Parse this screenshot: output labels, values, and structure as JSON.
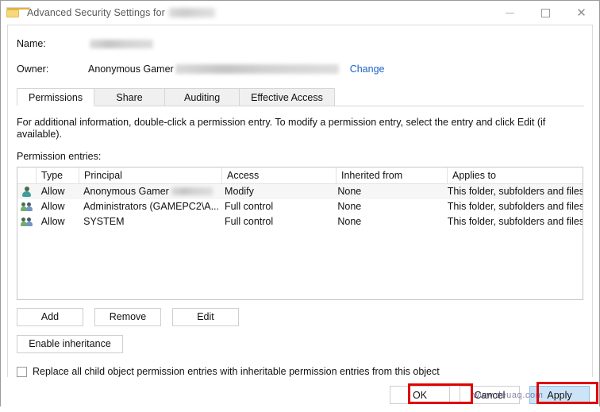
{
  "window": {
    "title_prefix": "Advanced Security Settings for",
    "title_target_redacted": true,
    "icon": "folder-icon",
    "controls": {
      "minimize": "–",
      "maximize": "□",
      "close": "✕"
    }
  },
  "fields": {
    "name_label": "Name:",
    "name_value_redacted": true,
    "owner_label": "Owner:",
    "owner_value": "Anonymous Gamer",
    "owner_email_redacted": true,
    "change_link": "Change"
  },
  "tabs": [
    {
      "label": "Permissions",
      "active": true
    },
    {
      "label": "Share",
      "active": false
    },
    {
      "label": "Auditing",
      "active": false
    },
    {
      "label": "Effective Access",
      "active": false
    }
  ],
  "info_text": "For additional information, double-click a permission entry. To modify a permission entry, select the entry and click Edit (if available).",
  "entries_label": "Permission entries:",
  "table": {
    "headers": [
      "",
      "Type",
      "Principal",
      "Access",
      "Inherited from",
      "Applies to"
    ],
    "rows": [
      {
        "icon": "user-icon",
        "type": "Allow",
        "principal": "Anonymous Gamer",
        "principal_redacted": true,
        "access": "Modify",
        "inherited_from": "None",
        "applies_to": "This folder, subfolders and files"
      },
      {
        "icon": "group-icon",
        "type": "Allow",
        "principal": "Administrators (GAMEPC2\\A...",
        "principal_redacted": false,
        "access": "Full control",
        "inherited_from": "None",
        "applies_to": "This folder, subfolders and files"
      },
      {
        "icon": "group-icon",
        "type": "Allow",
        "principal": "SYSTEM",
        "principal_redacted": false,
        "access": "Full control",
        "inherited_from": "None",
        "applies_to": "This folder, subfolders and files"
      }
    ]
  },
  "actions": {
    "add": "Add",
    "remove": "Remove",
    "edit": "Edit",
    "enable_inheritance": "Enable inheritance"
  },
  "checkbox": {
    "label": "Replace all child object permission entries with inheritable permission entries from this object",
    "checked": false
  },
  "footer": {
    "ok": "OK",
    "cancel": "Cancel",
    "apply": "Apply",
    "apply_hovered": true
  },
  "annotations": {
    "highlight_color": "#e00000",
    "highlighted": [
      "OK",
      "Apply"
    ]
  },
  "watermark": "www.deuaq.com"
}
